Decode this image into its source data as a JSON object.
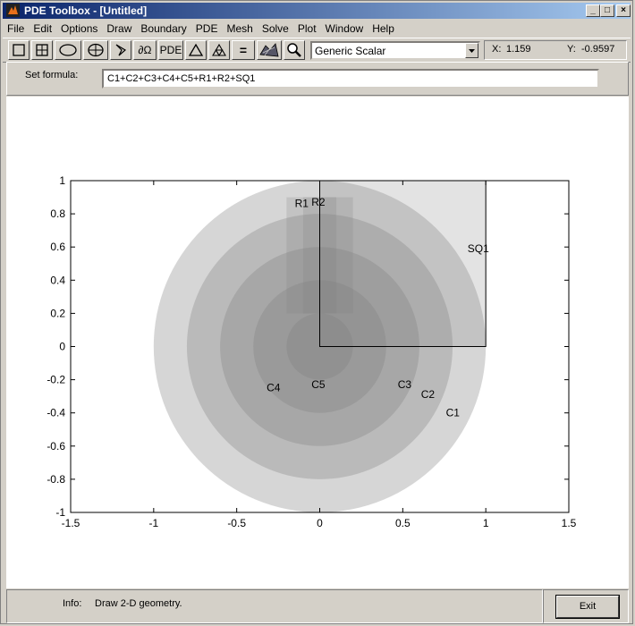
{
  "window": {
    "title": "PDE Toolbox - [Untitled]"
  },
  "menu": [
    "File",
    "Edit",
    "Options",
    "Draw",
    "Boundary",
    "PDE",
    "Mesh",
    "Solve",
    "Plot",
    "Window",
    "Help"
  ],
  "toolbar": {
    "buttons": [
      {
        "name": "rectangle-tool",
        "icon": "rectangle-icon"
      },
      {
        "name": "centered-rectangle-tool",
        "icon": "centered-rectangle-icon"
      },
      {
        "name": "ellipse-tool",
        "icon": "ellipse-icon"
      },
      {
        "name": "centered-ellipse-tool",
        "icon": "centered-ellipse-icon"
      },
      {
        "name": "polygon-tool",
        "icon": "polygon-icon"
      },
      {
        "name": "boundary-mode-button",
        "label": "∂Ω"
      },
      {
        "name": "pde-spec-button",
        "label": "PDE"
      },
      {
        "name": "init-mesh-button",
        "icon": "triangle-icon"
      },
      {
        "name": "refine-mesh-button",
        "icon": "refined-triangle-icon"
      },
      {
        "name": "solve-button",
        "label": "="
      },
      {
        "name": "plot-button",
        "icon": "surface-plot-icon"
      },
      {
        "name": "zoom-button",
        "icon": "zoom-icon"
      }
    ],
    "application_mode": "Generic Scalar",
    "x_label": "X:",
    "x_value": "1.159",
    "y_label": "Y:",
    "y_value": "-0.9597"
  },
  "formula": {
    "label": "Set formula:",
    "value": "C1+C2+C3+C4+C5+R1+R2+SQ1"
  },
  "chart_data": {
    "type": "scatter",
    "xlim": [
      -1.5,
      1.5
    ],
    "ylim": [
      -1,
      1
    ],
    "x_ticks": [
      "-1.5",
      "-1",
      "-0.5",
      "0",
      "0.5",
      "1",
      "1.5"
    ],
    "y_ticks": [
      "1",
      "0.8",
      "0.6",
      "0.4",
      "0.2",
      "0",
      "-0.2",
      "-0.4",
      "-0.6",
      "-0.8",
      "-1"
    ],
    "x_tick_values": [
      -1.5,
      -1,
      -0.5,
      0,
      0.5,
      1,
      1.5
    ],
    "y_tick_values": [
      1,
      0.8,
      0.6,
      0.4,
      0.2,
      0,
      -0.2,
      -0.4,
      -0.6,
      -0.8,
      -1
    ],
    "circles": [
      {
        "name": "C1",
        "cx": 0,
        "cy": 0,
        "r": 1.0,
        "label": "C1",
        "lx": 0.76,
        "ly": -0.42
      },
      {
        "name": "C2",
        "cx": 0,
        "cy": 0,
        "r": 0.8,
        "label": "C2",
        "lx": 0.61,
        "ly": -0.31
      },
      {
        "name": "C3",
        "cx": 0,
        "cy": 0,
        "r": 0.6,
        "label": "C3",
        "lx": 0.47,
        "ly": -0.25
      },
      {
        "name": "C4",
        "cx": 0,
        "cy": 0,
        "r": 0.4,
        "label": "C4",
        "lx": -0.32,
        "ly": -0.27
      },
      {
        "name": "C5",
        "cx": 0,
        "cy": 0,
        "r": 0.2,
        "label": "C5",
        "lx": -0.05,
        "ly": -0.25
      }
    ],
    "rectangles": [
      {
        "name": "R1",
        "x0": -0.2,
        "y0": 0.2,
        "x1": 0.1,
        "y1": 0.9,
        "label": "R1",
        "lx": -0.15,
        "ly": 0.84
      },
      {
        "name": "R2",
        "x0": -0.1,
        "y0": 0.2,
        "x1": 0.2,
        "y1": 0.9,
        "label": "R2",
        "lx": -0.05,
        "ly": 0.85
      },
      {
        "name": "SQ1",
        "x0": 0,
        "y0": 0,
        "x1": 1,
        "y1": 1,
        "label": "SQ1",
        "lx": 0.89,
        "ly": 0.57
      }
    ]
  },
  "status": {
    "info_label": "Info:",
    "info_text": "Draw 2-D geometry."
  },
  "exit_label": "Exit"
}
